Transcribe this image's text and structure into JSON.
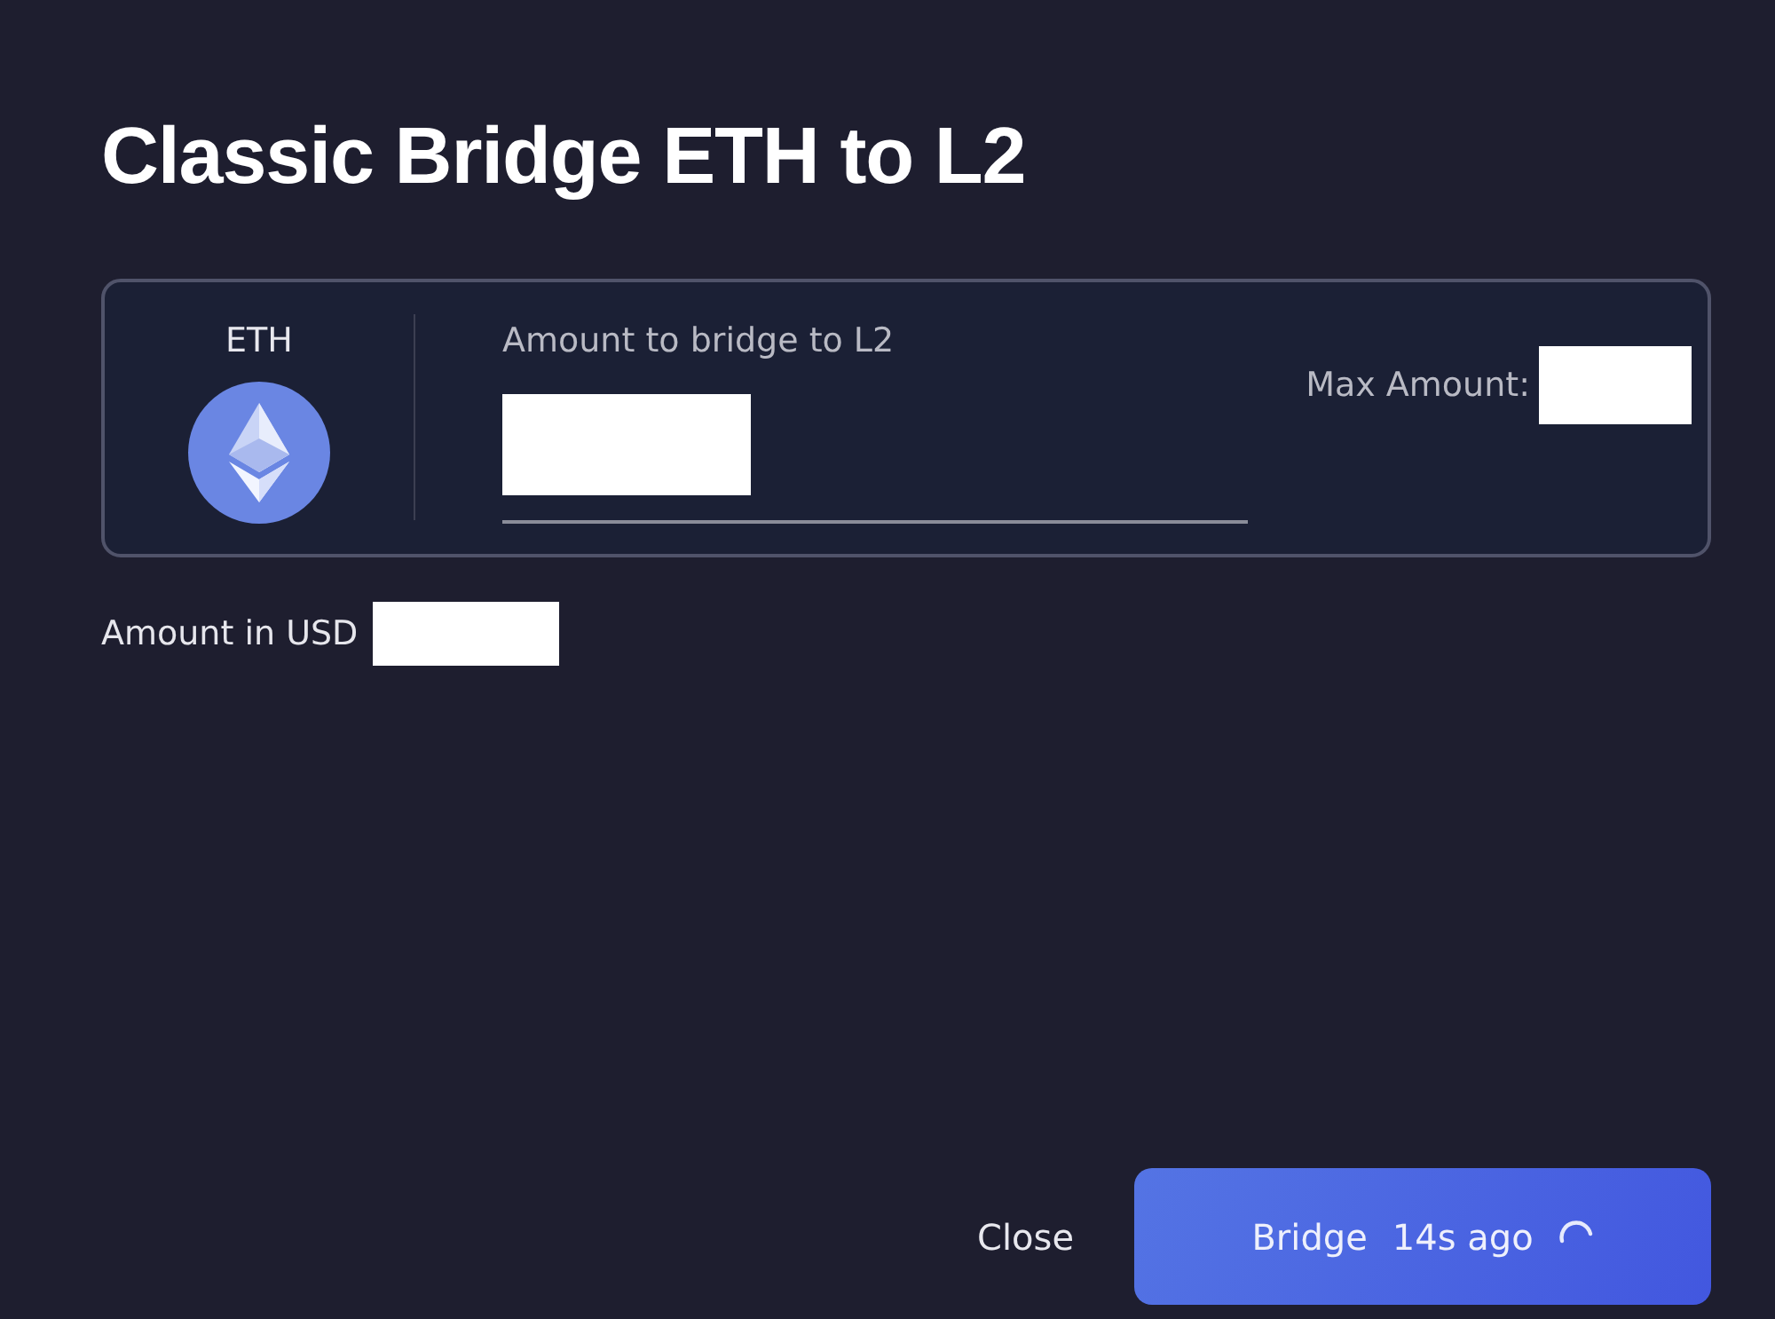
{
  "dialog": {
    "title": "Classic Bridge ETH to L2"
  },
  "token": {
    "symbol": "ETH"
  },
  "amount_field": {
    "label": "Amount to bridge to L2",
    "redacted": true
  },
  "max_amount": {
    "label": "Max Amount:",
    "redacted": true
  },
  "usd_amount": {
    "label": "Amount in USD",
    "redacted": true
  },
  "buttons": [
    {
      "label": "Close",
      "kind": "text"
    },
    {
      "label": "Bridge",
      "kind": "primary",
      "status": "14s ago",
      "loading": true
    }
  ]
}
